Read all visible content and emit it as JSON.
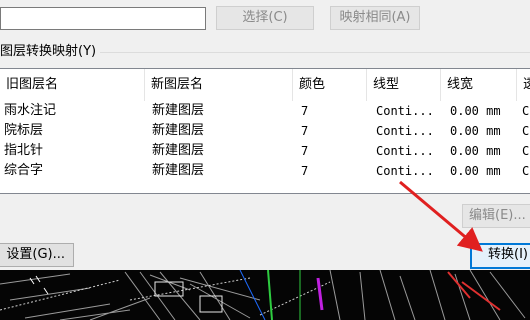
{
  "top": {
    "select_button_label": "选择(C)",
    "map_same_button_label": "映射相同(A)"
  },
  "mapping_group": {
    "title": "图层转换映射(Y)"
  },
  "table": {
    "columns": [
      "旧图层名",
      "新图层名",
      "颜色",
      "线型",
      "线宽",
      "透"
    ],
    "rows": [
      {
        "old": "雨水注记",
        "new": "新建图层",
        "color": "7",
        "linetype": "Conti...",
        "lineweight": "0.00 mm",
        "extra": "C"
      },
      {
        "old": "院标层",
        "new": "新建图层",
        "color": "7",
        "linetype": "Conti...",
        "lineweight": "0.00 mm",
        "extra": "C"
      },
      {
        "old": "指北针",
        "new": "新建图层",
        "color": "7",
        "linetype": "Conti...",
        "lineweight": "0.00 mm",
        "extra": "C"
      },
      {
        "old": "综合字",
        "new": "新建图层",
        "color": "7",
        "linetype": "Conti...",
        "lineweight": "0.00 mm",
        "extra": "C"
      }
    ]
  },
  "buttons": {
    "edit_label": "编辑(E)...",
    "settings_label": "设置(G)...",
    "convert_label": "转换(I)"
  },
  "colors": {
    "annotation_arrow": "#e02020",
    "accent": "#0078d7"
  }
}
